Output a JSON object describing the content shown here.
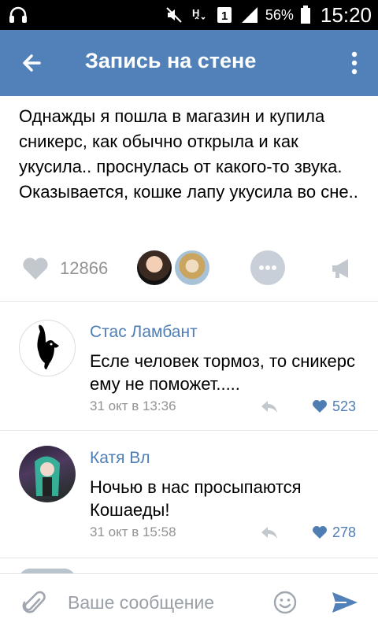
{
  "status_bar": {
    "battery": "56%",
    "time": "15:20",
    "sim_number": "1"
  },
  "app_bar": {
    "title": "Запись на стене"
  },
  "post": {
    "text": "Однажды я пошла в магазин и купила сникерс, как обычно открыла и как укусила.. проснулась от какого-то звука. Оказывается, кошке лапу укусила во сне..",
    "likes": "12866"
  },
  "comments": [
    {
      "author": "Стас Ламбант",
      "text": "Есле человек тормоз, то сникерс ему не поможет.....",
      "date": "31 окт в 13:36",
      "likes": "523"
    },
    {
      "author": "Катя Вл",
      "text": "Ночью в нас просыпаются Кошаеды!",
      "date": "31 окт в 15:58",
      "likes": "278"
    }
  ],
  "composer": {
    "placeholder": "Ваше сообщение"
  },
  "colors": {
    "accent": "#5181b8",
    "link": "#4f7eb5",
    "muted": "#939393"
  },
  "icons": [
    "headphones-icon",
    "mute-icon",
    "h-plus-icon",
    "signal-icon",
    "battery-icon",
    "back-arrow-icon",
    "more-vert-icon",
    "heart-icon",
    "more-horizontal-icon",
    "megaphone-icon",
    "reply-icon",
    "paperclip-icon",
    "smile-icon",
    "send-icon"
  ]
}
